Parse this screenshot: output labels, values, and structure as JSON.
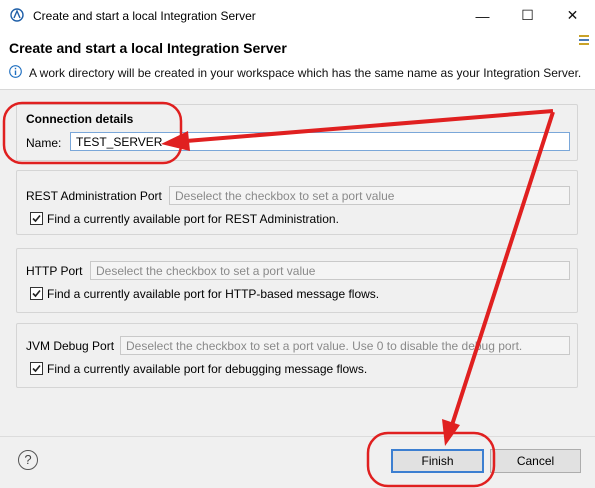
{
  "window": {
    "title": "Create and start a local Integration Server",
    "minimize": "—",
    "maximize": "☐",
    "close": "✕"
  },
  "header": {
    "title": "Create and start a local Integration Server",
    "message": "A work directory will be created in your workspace which has the same name as your Integration Server."
  },
  "connection": {
    "group_label": "Connection details",
    "name_label": "Name:",
    "name_value": "TEST_SERVER"
  },
  "rest": {
    "label": "REST Administration Port",
    "placeholder": "Deselect the checkbox to set a port value",
    "checkbox_label": "Find a currently available port for REST Administration.",
    "checked": true
  },
  "http": {
    "label": "HTTP Port",
    "placeholder": "Deselect the checkbox to set a port value",
    "checkbox_label": "Find a currently available port for HTTP-based message flows.",
    "checked": true
  },
  "jvm": {
    "label": "JVM Debug Port",
    "placeholder": "Deselect the checkbox to set a port value. Use 0 to disable the debug port.",
    "checkbox_label": "Find a currently available port for debugging message flows.",
    "checked": true
  },
  "footer": {
    "help_glyph": "?",
    "finish_label": "Finish",
    "cancel_label": "Cancel"
  },
  "annotation_color": "#e02020"
}
